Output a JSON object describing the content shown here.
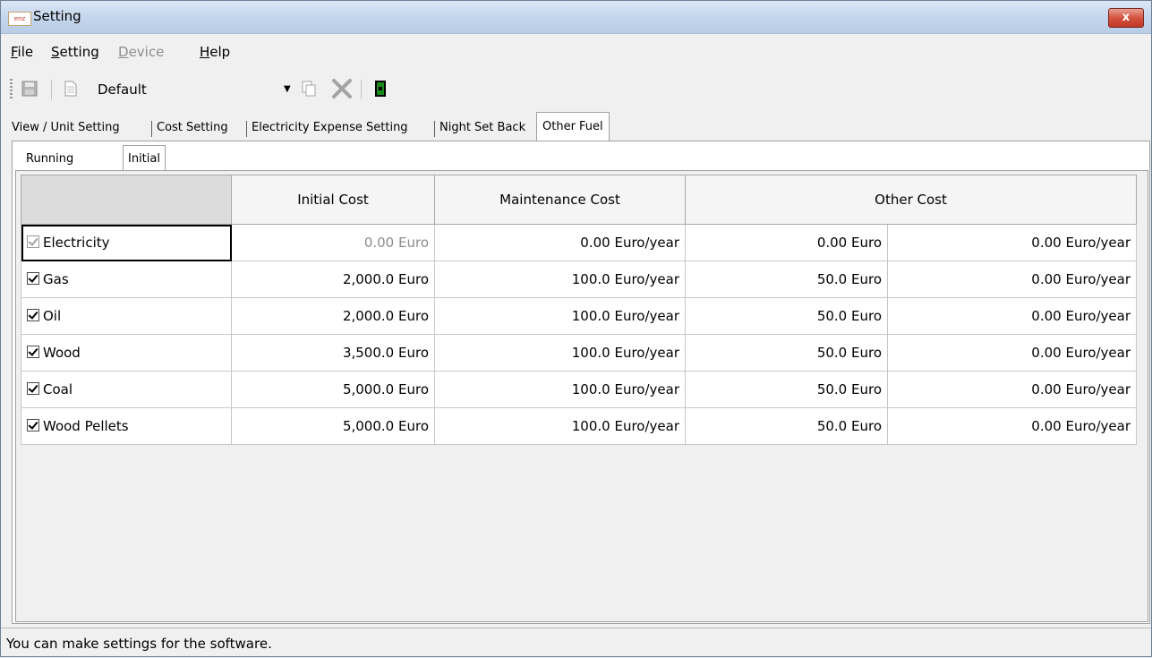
{
  "window": {
    "title": "Setting",
    "app_icon": "app-logo-icon",
    "close_label": "x"
  },
  "menu": [
    {
      "label": "File",
      "key": "F",
      "rest": "ile",
      "enabled": true
    },
    {
      "label": "Setting",
      "key": "S",
      "rest": "etting",
      "enabled": true
    },
    {
      "label": "Device",
      "key": "D",
      "rest": "evice",
      "enabled": false
    },
    {
      "label": "Help",
      "key": "H",
      "rest": "elp",
      "enabled": true
    }
  ],
  "toolbar": {
    "profile_value": "Default"
  },
  "tabs": [
    {
      "label": "View / Unit Setting",
      "active": false
    },
    {
      "label": "Cost Setting",
      "active": false
    },
    {
      "label": "Electricity Expense Setting",
      "active": false
    },
    {
      "label": "Night Set Back",
      "active": false
    },
    {
      "label": "Other Fuel",
      "active": true
    }
  ],
  "subtabs": [
    {
      "label": "Running Cost",
      "active": false
    },
    {
      "label": "Initial Cost",
      "active": true
    }
  ],
  "table": {
    "headers": [
      "",
      "Initial Cost",
      "Maintenance Cost",
      "Other Cost"
    ],
    "rows": [
      {
        "fuel": "Electricity",
        "checked": true,
        "enabled": false,
        "initial": "0.00",
        "initial_unit": "Euro",
        "maintenance": "0.00",
        "maintenance_unit": "Euro/year",
        "other1": "0.00",
        "other1_unit": "Euro",
        "other2": "0.00",
        "other2_unit": "Euro/year"
      },
      {
        "fuel": "Gas",
        "checked": true,
        "enabled": true,
        "initial": "2,000.0",
        "initial_unit": "Euro",
        "maintenance": "100.0",
        "maintenance_unit": "Euro/year",
        "other1": "50.0",
        "other1_unit": "Euro",
        "other2": "0.00",
        "other2_unit": "Euro/year"
      },
      {
        "fuel": "Oil",
        "checked": true,
        "enabled": true,
        "initial": "2,000.0",
        "initial_unit": "Euro",
        "maintenance": "100.0",
        "maintenance_unit": "Euro/year",
        "other1": "50.0",
        "other1_unit": "Euro",
        "other2": "0.00",
        "other2_unit": "Euro/year"
      },
      {
        "fuel": "Wood",
        "checked": true,
        "enabled": true,
        "initial": "3,500.0",
        "initial_unit": "Euro",
        "maintenance": "100.0",
        "maintenance_unit": "Euro/year",
        "other1": "50.0",
        "other1_unit": "Euro",
        "other2": "0.00",
        "other2_unit": "Euro/year"
      },
      {
        "fuel": "Coal",
        "checked": true,
        "enabled": true,
        "initial": "5,000.0",
        "initial_unit": "Euro",
        "maintenance": "100.0",
        "maintenance_unit": "Euro/year",
        "other1": "50.0",
        "other1_unit": "Euro",
        "other2": "0.00",
        "other2_unit": "Euro/year"
      },
      {
        "fuel": "Wood Pellets",
        "checked": true,
        "enabled": true,
        "initial": "5,000.0",
        "initial_unit": "Euro",
        "maintenance": "100.0",
        "maintenance_unit": "Euro/year",
        "other1": "50.0",
        "other1_unit": "Euro",
        "other2": "0.00",
        "other2_unit": "Euro/year"
      }
    ]
  },
  "status": {
    "text": "You can make settings for the software."
  },
  "colors": {
    "accent_green": "#1a8a1a",
    "titlebar": "#c5d6ec",
    "close_red": "#c03925"
  }
}
